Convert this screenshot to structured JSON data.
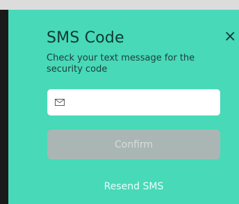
{
  "modal": {
    "title": "SMS Code",
    "subtitle": "Check your text message for the security code",
    "close_symbol": "×",
    "input": {
      "placeholder": "",
      "value": ""
    },
    "confirm_label": "Confirm",
    "resend_label": "Resend SMS"
  },
  "icons": {
    "close": "close-icon",
    "input": "mail-icon"
  },
  "colors": {
    "modal_bg": "#47d9b8",
    "text_dark": "#0f3a33",
    "button_disabled_bg": "#aab6b4",
    "resend_text": "#e9fffb"
  }
}
